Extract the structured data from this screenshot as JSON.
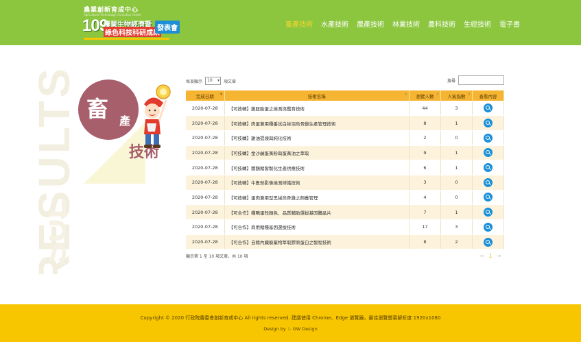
{
  "header": {
    "logo": {
      "top": "農業創新育成中心",
      "sub": "Agricultural Technology Innovation Center",
      "number": "109",
      "line1": "農業生物經濟暨",
      "line2": "綠色科技科研成果",
      "badge": "發表會"
    },
    "nav": [
      "畜產技術",
      "水產技術",
      "農產技術",
      "林業技術",
      "農科技術",
      "生經技術",
      "電子書"
    ],
    "nav_active_index": 0
  },
  "decoration": {
    "watermark": "RESULTS",
    "watermark2": "SUL"
  },
  "category": {
    "big_char": "畜",
    "small_char": "產",
    "label": "技術"
  },
  "controls": {
    "length_prefix": "每頁顯示",
    "length_value": "10",
    "length_suffix": "項文章",
    "search_label": "搜尋"
  },
  "table": {
    "columns": [
      "完成日期",
      "技術名稱",
      "瀏覽人數",
      "人氣指數",
      "查看內容"
    ],
    "rows": [
      {
        "date": "2020-07-28",
        "name": "【可技轉】雞胚胎蛋之檢測與鑑育技術",
        "views": "44",
        "popularity": "3"
      },
      {
        "date": "2020-07-28",
        "name": "【可技轉】肉蛋兼用種番試白絲羽烏骨雞生產管理技術",
        "views": "8",
        "popularity": "1"
      },
      {
        "date": "2020-07-28",
        "name": "【可技轉】雞油提煉與純化技術",
        "views": "2",
        "popularity": "0"
      },
      {
        "date": "2020-07-28",
        "name": "【可技轉】金沙鹹蛋黃粉與蛋黃油之萃取",
        "views": "9",
        "popularity": "1"
      },
      {
        "date": "2020-07-28",
        "name": "【可技轉】醬鵝豬客製化生產供應技術",
        "views": "6",
        "popularity": "1"
      },
      {
        "date": "2020-07-28",
        "name": "【可技轉】牛隻熱影像檢測辨識技術",
        "views": "3",
        "popularity": "0"
      },
      {
        "date": "2020-07-28",
        "name": "【可技轉】蛋肉兼用型黑絨烏骨雞之飼養管理",
        "views": "4",
        "popularity": "0"
      },
      {
        "date": "2020-07-28",
        "name": "【可合作】種鴨蛋殼顏色、品質輔助選拔基因體晶片",
        "views": "7",
        "popularity": "1"
      },
      {
        "date": "2020-07-28",
        "name": "【可合作】商用豬種基因選拔技術",
        "views": "17",
        "popularity": "3"
      },
      {
        "date": "2020-07-28",
        "name": "【可合作】自豬內臟廢棄物萃取膠原蛋白之製程技術",
        "views": "8",
        "popularity": "2"
      }
    ]
  },
  "info": "顯示第 1 至 10 項文章，共 10 項",
  "pager": {
    "prev": "←",
    "current": "1",
    "next": "→"
  },
  "footer": {
    "copyright": "Copyright © 2020 行政院農委會創新育成中心 All rights reserved.    建議使用 Chrome、Edge 瀏覽器，最佳瀏覽螢幕解析度 1920x1080",
    "design": "Design by ♘ GW Design"
  },
  "colors": {
    "header_bg": "#8cc63f",
    "nav_active": "#f7d72a",
    "table_head": "#f5b533",
    "row_alt": "#fdf3dc",
    "view_button": "#1a90d8",
    "footer_bg": "#f7c600",
    "category_circle": "#a85f6c"
  }
}
